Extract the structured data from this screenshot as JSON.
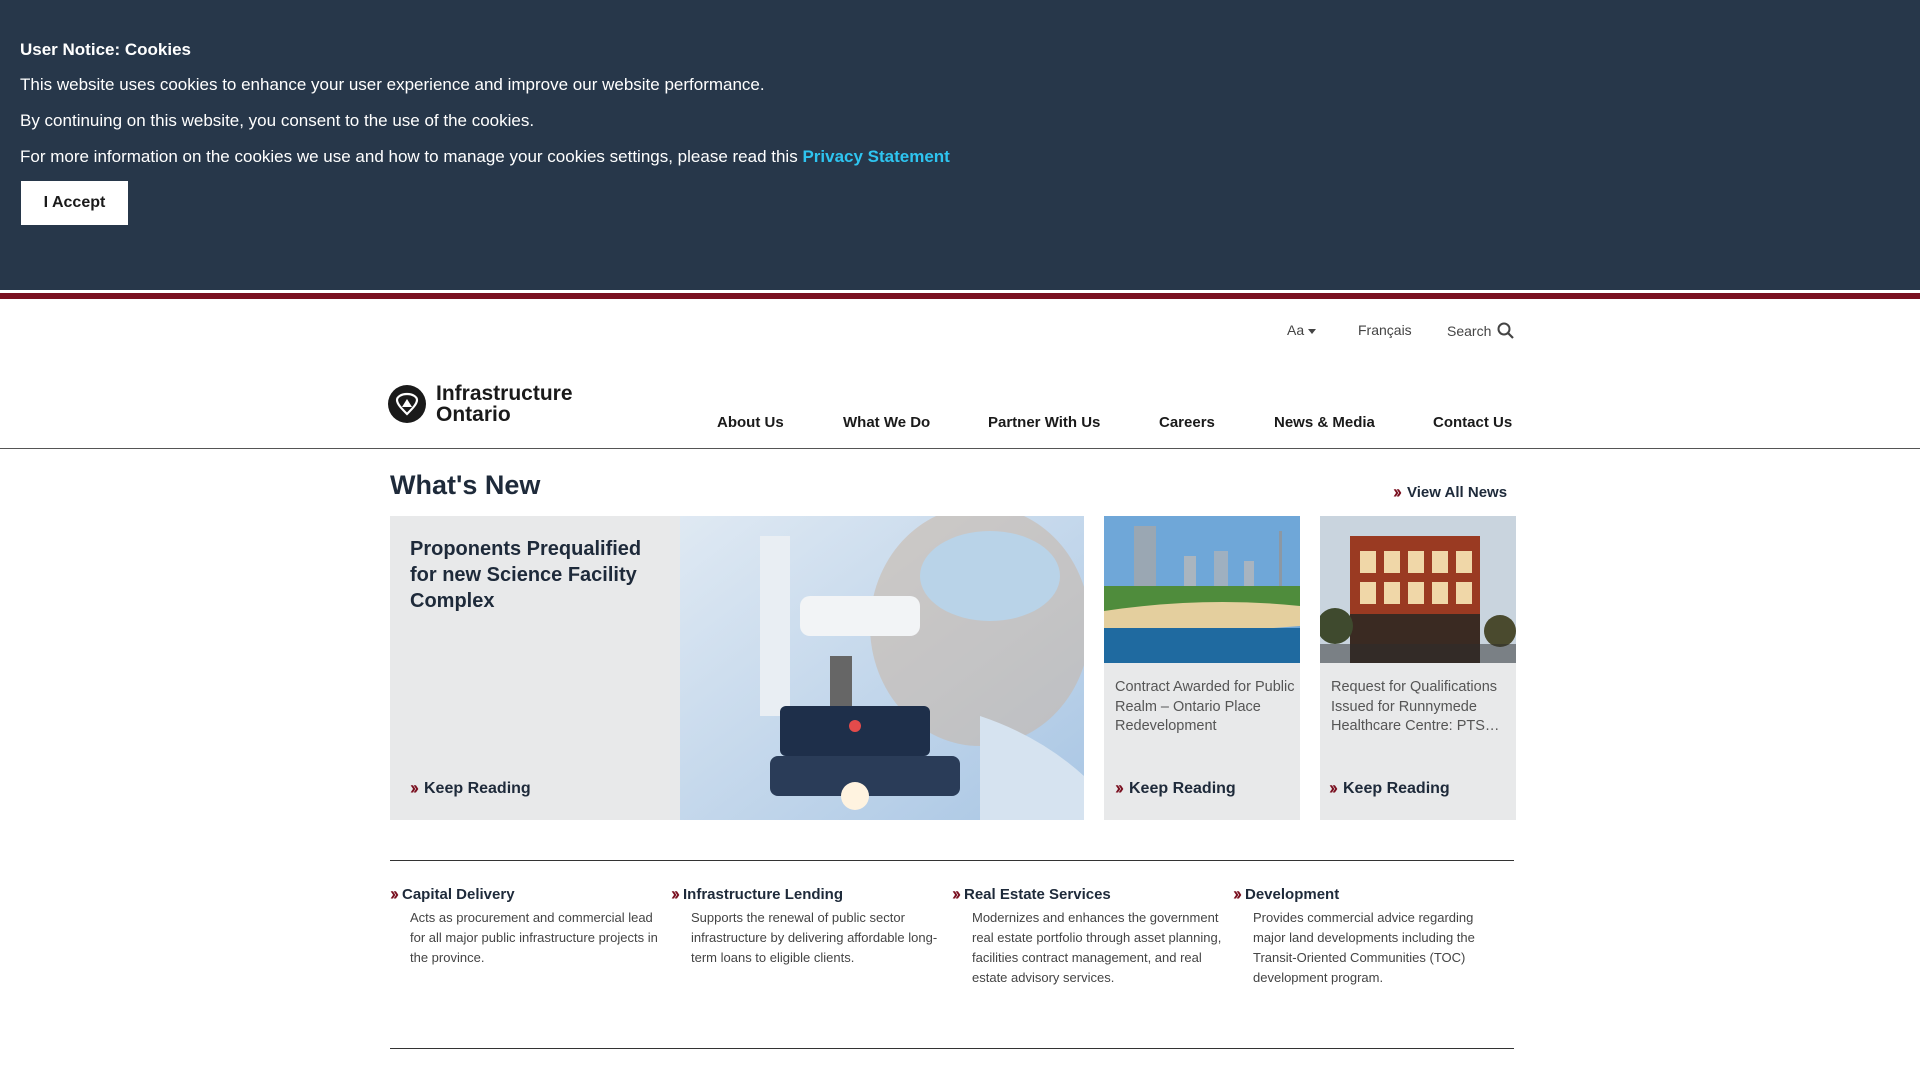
{
  "cookie_banner": {
    "title": "User Notice: Cookies",
    "line1": "This website uses cookies to enhance your user experience and improve our website performance.",
    "line2": "By continuing on this website, you consent to the use of the cookies.",
    "line3_prefix": "For more information on the cookies we use and how to manage your cookies settings, please read this",
    "privacy_link": "Privacy Statement",
    "accept_label": "I Accept",
    "bg_color": "#27374a",
    "link_color": "#2ec4f0"
  },
  "utility_nav": {
    "text_size": "Aa",
    "language": "Français",
    "search": "Search"
  },
  "logo": {
    "line1": "Infrastructure",
    "line2": "Ontario"
  },
  "main_nav": [
    "About Us",
    "What We Do",
    "Partner With Us",
    "Careers",
    "News & Media",
    "Contact Us"
  ],
  "whats_new": {
    "title": "What's New",
    "view_all": "View All News",
    "feature": {
      "title": "Proponents Prequalified for new Science Facility Complex",
      "cta": "Keep Reading",
      "image": "microscope-lab-photo"
    },
    "cards": [
      {
        "text": "Contract Awarded for Public Realm – Ontario Place Redevelopment",
        "cta": "Keep Reading",
        "image": "waterfront-park-rendering"
      },
      {
        "text": "Request for Qualifications Issued for Runnymede Healthcare Centre: PTS…",
        "cta": "Keep Reading",
        "image": "brick-building-rendering"
      }
    ]
  },
  "services": [
    {
      "title": "Capital Delivery",
      "desc": "Acts as procurement and commercial lead for all major public infrastructure projects in the province."
    },
    {
      "title": "Infrastructure Lending",
      "desc": "Supports the renewal of public sector infrastructure by delivering affordable long-term loans to eligible clients."
    },
    {
      "title": "Real Estate Services",
      "desc": "Modernizes and enhances the government real estate portfolio through asset planning, facilities contract management, and real estate advisory services."
    },
    {
      "title": "Development",
      "desc": "Provides commercial advice regarding major land developments including the Transit-Oriented Communities (TOC) development program."
    }
  ],
  "colors": {
    "accent_red": "#7a1020",
    "heading_navy": "#1e2a3a"
  }
}
